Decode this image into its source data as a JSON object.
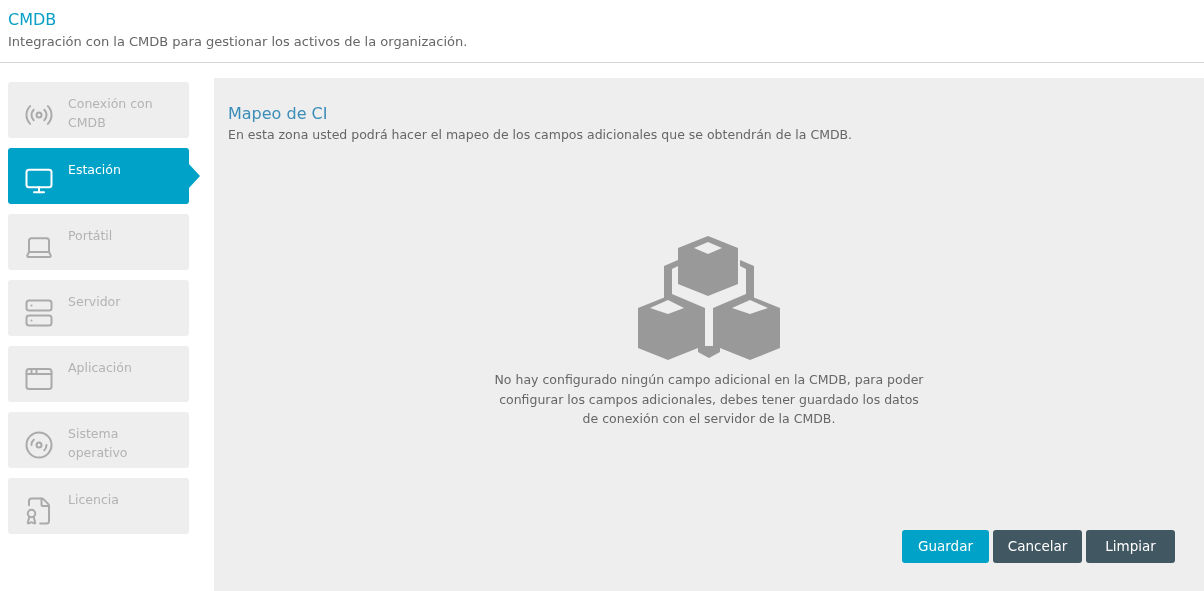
{
  "header": {
    "title": "CMDB",
    "subtitle": "Integración con la CMDB para gestionar los activos de la organización."
  },
  "sidebar": {
    "items": [
      {
        "kind": "antenna",
        "label": "Conexión con CMDB",
        "selected": false
      },
      {
        "kind": "desktop",
        "label": "Estación",
        "selected": true
      },
      {
        "kind": "laptop",
        "label": "Portátil",
        "selected": false
      },
      {
        "kind": "server",
        "label": "Servidor",
        "selected": false
      },
      {
        "kind": "app",
        "label": "Aplicación",
        "selected": false
      },
      {
        "kind": "disc",
        "label": "Sistema operativo",
        "selected": false
      },
      {
        "kind": "license",
        "label": "Licencia",
        "selected": false
      }
    ]
  },
  "panel": {
    "title": "Mapeo de CI",
    "description": "En esta zona usted podrá hacer el mapeo de los campos adicionales que se obtendrán de la CMDB.",
    "empty_message": "No hay configurado ningún campo adicional en la CMDB, para poder configurar los campos adicionales, debes tener guardado los datos de conexión con el servidor de la CMDB.",
    "buttons": [
      {
        "kind": "primary",
        "label": "Guardar"
      },
      {
        "kind": "secondary",
        "label": "Cancelar"
      },
      {
        "kind": "secondary",
        "label": "Limpiar"
      }
    ]
  }
}
